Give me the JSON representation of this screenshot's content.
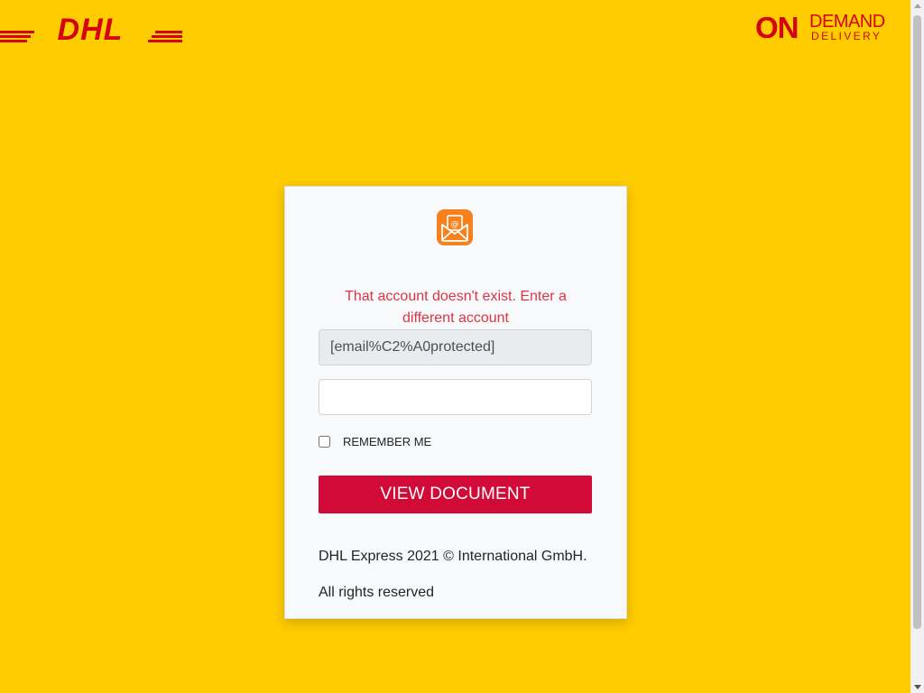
{
  "header": {
    "dhl_logo_text": "DHL",
    "dhl_brand_color": "#d40511",
    "partner_logo": {
      "on": "ON",
      "demand": "DEMAND",
      "delivery": "DELIVERY"
    }
  },
  "colors": {
    "background": "#ffcc00",
    "card": "#f8f9fa",
    "error": "#dc3545",
    "button": "#d20a37",
    "mail_icon": "#f5821f"
  },
  "login": {
    "icon": "mail-at-icon",
    "error_message": "That account doesn't exist. Enter a different account",
    "email_value": "[email%C2%A0protected]",
    "password_value": "",
    "remember_label": "REMEMBER ME",
    "remember_checked": false,
    "submit_label": "VIEW DOCUMENT"
  },
  "footer": {
    "line1": "DHL Express 2021 © International GmbH.",
    "line2": "All rights reserved"
  }
}
